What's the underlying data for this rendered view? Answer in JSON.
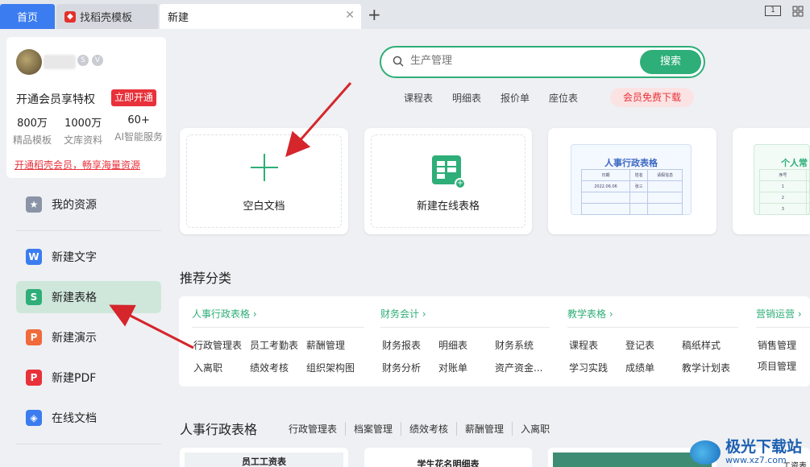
{
  "tabs": {
    "home": "首页",
    "find_template": "找稻壳模板",
    "new": "新建"
  },
  "window_controls": {
    "box1": "1"
  },
  "user_card": {
    "vip_text": "开通会员享特权",
    "vip_button": "立即开通",
    "stats": [
      {
        "value": "800万",
        "label": "精品模板"
      },
      {
        "value": "1000万",
        "label": "文库资料"
      },
      {
        "value": "60+",
        "label": "AI智能服务"
      }
    ],
    "promo": "开通稻壳会员，畅享海量资源"
  },
  "sidebar": {
    "items": [
      {
        "label": "我的资源",
        "icon": "star-icon",
        "color": "#8a94a6"
      },
      {
        "label": "新建文字",
        "icon": "writer-icon",
        "color": "#3b7cf0"
      },
      {
        "label": "新建表格",
        "icon": "spreadsheet-icon",
        "color": "#2eae78"
      },
      {
        "label": "新建演示",
        "icon": "presentation-icon",
        "color": "#f06a3b"
      },
      {
        "label": "新建PDF",
        "icon": "pdf-icon",
        "color": "#e8313a"
      },
      {
        "label": "在线文档",
        "icon": "cloud-doc-icon",
        "color": "#3b7cf0"
      }
    ]
  },
  "search": {
    "placeholder": "生产管理",
    "button": "搜索",
    "quick_links": [
      "课程表",
      "明细表",
      "报价单",
      "座位表"
    ],
    "vip_download": "会员免费下载"
  },
  "cards": {
    "blank_doc": "空白文档",
    "online_sheet": "新建在线表格",
    "template1_title": "人事行政表格",
    "template1_row": [
      "2022.06.06",
      "张三"
    ],
    "template1_head": [
      "日期",
      "姓名",
      "请假信息"
    ],
    "template2_title": "个人常",
    "template2_head": [
      "序号"
    ],
    "template2_rows": [
      "1",
      "2",
      "3"
    ]
  },
  "recommend": {
    "title": "推荐分类",
    "categories": [
      {
        "head": "人事行政表格 ›",
        "items": [
          "行政管理表",
          "员工考勤表",
          "薪酬管理",
          "入离职",
          "绩效考核",
          "组织架构图"
        ]
      },
      {
        "head": "财务会计 ›",
        "items": [
          "财务报表",
          "明细表",
          "财务系统",
          "财务分析",
          "对账单",
          "资产资金..."
        ]
      },
      {
        "head": "教学表格 ›",
        "items": [
          "课程表",
          "登记表",
          "稿纸样式",
          "学习实践",
          "成绩单",
          "教学计划表"
        ]
      },
      {
        "head": "营销运营 ›",
        "items": [
          "销售管理",
          "项目管理"
        ]
      }
    ]
  },
  "hr_section": {
    "title": "人事行政表格",
    "tabs": [
      "行政管理表",
      "档案管理",
      "绩效考核",
      "薪酬管理",
      "入离职"
    ],
    "preview1": "员工工资表",
    "preview2": "学生花名明细表",
    "preview3": "工资表"
  },
  "watermark": {
    "title": "极光下载站",
    "url": "www.xz7.com"
  }
}
